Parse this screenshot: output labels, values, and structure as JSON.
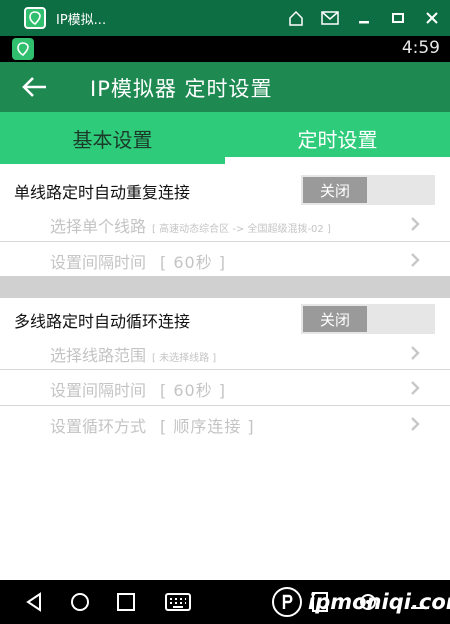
{
  "window": {
    "title": "IP模拟...",
    "controls": [
      "home-icon",
      "mail-icon",
      "minimize-icon",
      "maximize-icon",
      "close-icon"
    ]
  },
  "status_bar": {
    "time": "4:59"
  },
  "action_bar": {
    "title": "IP模拟器 定时设置"
  },
  "tabs": [
    {
      "label": "基本设置",
      "selected": false
    },
    {
      "label": "定时设置",
      "selected": true
    }
  ],
  "single": {
    "title": "单线路定时自动重复连接",
    "toggle_label": "关闭",
    "rows": [
      {
        "label": "选择单个线路",
        "detail": "[ 高速动态综合区 -> 全国超级混拨-02 ]"
      },
      {
        "label": "设置间隔时间",
        "value": "[ 60秒 ]"
      }
    ]
  },
  "multi": {
    "title": "多线路定时自动循环连接",
    "toggle_label": "关闭",
    "rows": [
      {
        "label": "选择线路范围",
        "detail": "[ 未选择线路 ]"
      },
      {
        "label": "设置间隔时间",
        "value": "[ 60秒 ]"
      },
      {
        "label": "设置循环方式",
        "value": "[ 顺序连接 ]"
      }
    ]
  },
  "watermark": "ipmoniqi.com",
  "colors": {
    "title_bar": "#0e6e43",
    "action_bar": "#1e8a52",
    "tab_bar": "#2ecc7a",
    "disabled_text": "#c4c4c4"
  }
}
